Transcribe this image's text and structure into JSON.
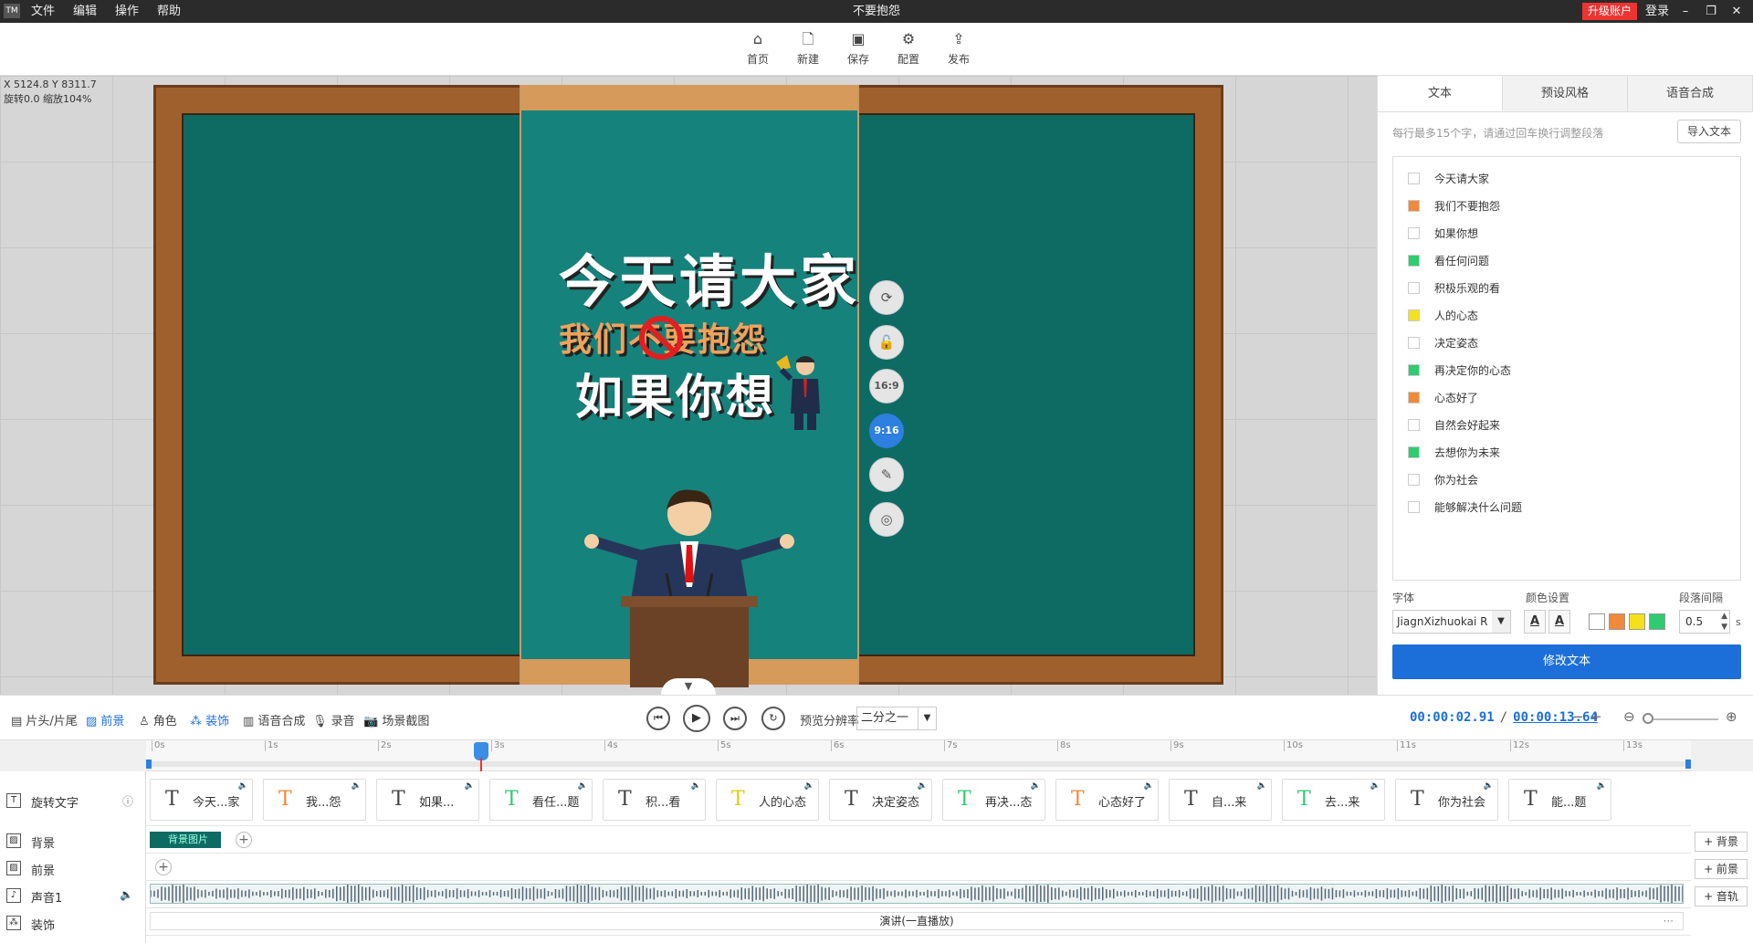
{
  "window": {
    "logo": "TM",
    "title": "不要抱怨",
    "menu": [
      "文件",
      "编辑",
      "操作",
      "帮助"
    ],
    "upgrade": "升级账户",
    "login": "登录"
  },
  "toolbar": {
    "home": "首页",
    "new": "新建",
    "save": "保存",
    "config": "配置",
    "publish": "发布"
  },
  "canvas": {
    "coords": "X 5124.8 Y 8311.7",
    "rotate_zoom": "旋转0.0 缩放104%",
    "line1": "今天请大家",
    "line2": "我们不要抱怨",
    "line3": "如果你想",
    "ratio_169": "16:9",
    "ratio_916": "9:16"
  },
  "right_panel": {
    "tabs": [
      "文本",
      "预设风格",
      "语音合成"
    ],
    "hint": "每行最多15个字，请通过回车换行调整段落",
    "import_label": "导入文本",
    "text_items": [
      {
        "label": "今天请大家",
        "color": "#ffffff"
      },
      {
        "label": "我们不要抱怨",
        "color": "#f0893a"
      },
      {
        "label": "如果你想",
        "color": "#ffffff"
      },
      {
        "label": "看任何问题",
        "color": "#2ecc71"
      },
      {
        "label": "积极乐观的看",
        "color": "#ffffff"
      },
      {
        "label": "人的心态",
        "color": "#f5e11b"
      },
      {
        "label": "决定姿态",
        "color": "#ffffff"
      },
      {
        "label": "再决定你的心态",
        "color": "#2ecc71"
      },
      {
        "label": "心态好了",
        "color": "#f0893a"
      },
      {
        "label": "自然会好起来",
        "color": "#ffffff"
      },
      {
        "label": "去想你为未来",
        "color": "#2ecc71"
      },
      {
        "label": "你为社会",
        "color": "#ffffff"
      },
      {
        "label": "能够解决什么问题",
        "color": "#ffffff"
      }
    ],
    "font_label": "字体",
    "font_value": "JiagnXizhuokai R",
    "color_label": "颜色设置",
    "spacing_label": "段落间隔",
    "spacing_value": "0.5",
    "spacing_unit": "s",
    "swatches": [
      "#ffffff",
      "#f0893a",
      "#f5e11b",
      "#2ecc71"
    ],
    "modify_label": "修改文本"
  },
  "timeline_toolbar": {
    "items": [
      "片头/片尾",
      "前景",
      "角色",
      "装饰",
      "语音合成",
      "录音",
      "场景截图"
    ],
    "resolution_label": "预览分辨率",
    "resolution_value": "二分之一",
    "current_time": "00:00:02.91",
    "separator": "/",
    "total_time": "00:00:13.64"
  },
  "ruler": {
    "ticks": [
      "0s",
      "1s",
      "2s",
      "3s",
      "4s",
      "5s",
      "6s",
      "7s",
      "8s",
      "9s",
      "10s",
      "11s",
      "12s",
      "13s"
    ],
    "playhead_seconds": 2.91
  },
  "tracks": {
    "labels": [
      "旋转文字",
      "背景",
      "前景",
      "声音1",
      "装饰"
    ],
    "text_clips": [
      {
        "label": "今天...家",
        "color": "#444444"
      },
      {
        "label": "我...怨",
        "color": "#f0893a"
      },
      {
        "label": "如果...",
        "color": "#444444"
      },
      {
        "label": "看任...题",
        "color": "#2ecc71"
      },
      {
        "label": "积...看",
        "color": "#444444"
      },
      {
        "label": "人的心态",
        "color": "#e8c800"
      },
      {
        "label": "决定姿态",
        "color": "#444444"
      },
      {
        "label": "再决...态",
        "color": "#2ecc71"
      },
      {
        "label": "心态好了",
        "color": "#f0893a"
      },
      {
        "label": "自...来",
        "color": "#444444"
      },
      {
        "label": "去...来",
        "color": "#2ecc71"
      },
      {
        "label": "你为社会",
        "color": "#444444"
      },
      {
        "label": "能...题",
        "color": "#444444"
      }
    ],
    "bg_clip": "背景图片",
    "deco_clip": "演讲(一直播放)",
    "add_bg": "+ 背景",
    "add_fg": "+ 前景",
    "add_audio": "+ 音轨"
  }
}
